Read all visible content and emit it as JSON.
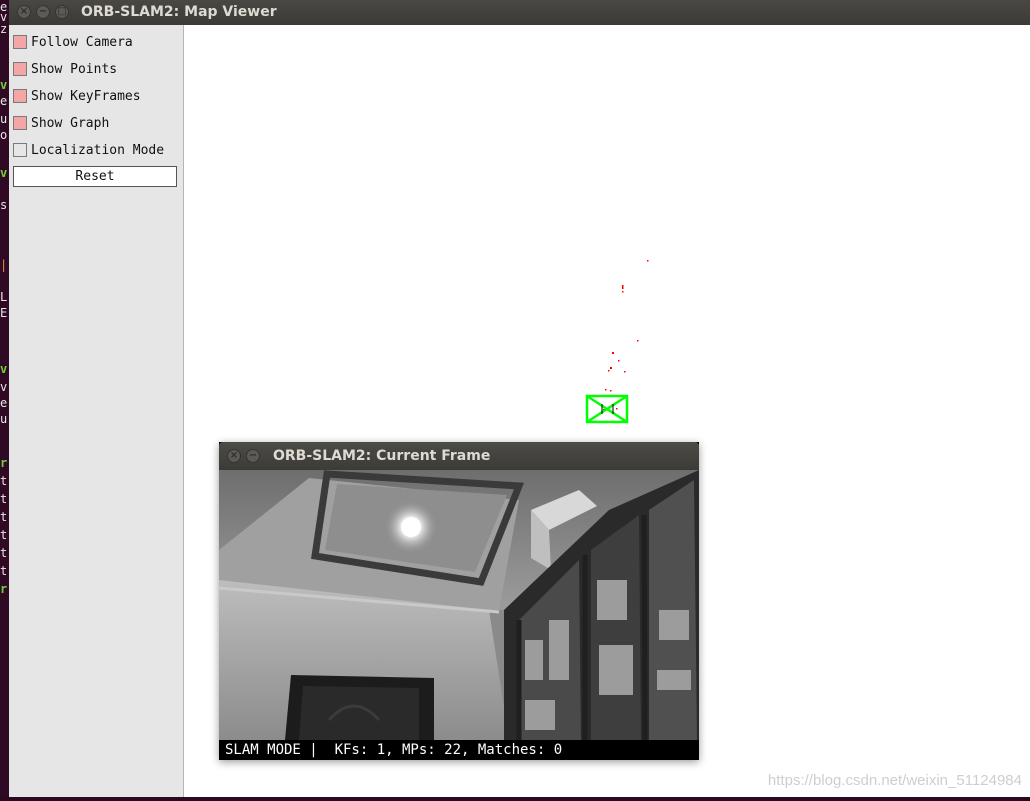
{
  "colors": {
    "checked": "#f4a5a5",
    "keyframe": "#00ff00",
    "map_point": "#ff0000"
  },
  "map_window": {
    "title": "ORB-SLAM2: Map Viewer",
    "controls": [
      {
        "label": "Follow Camera",
        "checked": true
      },
      {
        "label": "Show Points",
        "checked": true
      },
      {
        "label": "Show KeyFrames",
        "checked": true
      },
      {
        "label": "Show Graph",
        "checked": true
      },
      {
        "label": "Localization Mode",
        "checked": false
      }
    ],
    "reset_label": "Reset"
  },
  "frame_window": {
    "title": "ORB-SLAM2: Current Frame",
    "status_text": "SLAM MODE |  KFs: 1, MPs: 22, Matches: 0"
  },
  "watermark": "https://blog.csdn.net/weixin_51124984"
}
